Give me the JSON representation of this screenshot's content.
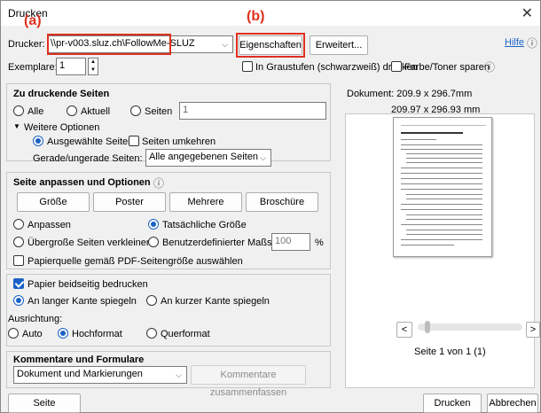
{
  "window": {
    "title": "Drucken"
  },
  "annotations": {
    "a": "(a)",
    "b": "(b)"
  },
  "printer": {
    "label": "Drucker:",
    "value": "\\\\pr-v003.sluz.ch\\FollowMe-SLUZ",
    "properties_button": "Eigenschaften",
    "advanced_button": "Erweitert...",
    "help_link": "Hilfe"
  },
  "copies": {
    "label": "Exemplare:",
    "value": "1",
    "grayscale_label": "In Graustufen (schwarzweiß) drucken",
    "save_ink_label": "Farbe/Toner sparen"
  },
  "pages": {
    "title": "Zu druckende Seiten",
    "all": "Alle",
    "current": "Aktuell",
    "pages": "Seiten",
    "pages_value": "1",
    "more_options": "Weitere Optionen",
    "selected_pages": "Ausgewählte Seiten",
    "reverse": "Seiten umkehren",
    "odd_even_label": "Gerade/ungerade Seiten:",
    "odd_even_value": "Alle angegebenen Seiten"
  },
  "sizing": {
    "title": "Seite anpassen und Optionen",
    "btn_size": "Größe",
    "btn_poster": "Poster",
    "btn_multiple": "Mehrere",
    "btn_booklet": "Broschüre",
    "fit": "Anpassen",
    "actual_size": "Tatsächliche Größe",
    "shrink": "Übergroße Seiten verkleinern",
    "custom_scale": "Benutzerdefinierter Maßstab:",
    "scale_value": "100",
    "percent": "%",
    "paper_source": "Papierquelle gemäß PDF-Seitengröße auswählen"
  },
  "duplex": {
    "label": "Papier beidseitig bedrucken",
    "long_edge": "An langer Kante spiegeln",
    "short_edge": "An kurzer Kante spiegeln",
    "orientation_label": "Ausrichtung:",
    "auto": "Auto",
    "portrait": "Hochformat",
    "landscape": "Querformat"
  },
  "comments": {
    "title": "Kommentare und Formulare",
    "value": "Dokument und Markierungen",
    "summarize": "Kommentare zusammenfassen"
  },
  "preview": {
    "document_size": "Dokument: 209.9 x 296.7mm",
    "page_size": "209.97 x 296.93 mm",
    "page_counter": "Seite 1 von 1 (1)",
    "prev": "<",
    "next": ">"
  },
  "footer": {
    "page_setup": "Seite einrichten...",
    "print": "Drucken",
    "cancel": "Abbrechen"
  },
  "colors": {
    "accent": "#1a62c6",
    "annotation": "#e0301e"
  }
}
